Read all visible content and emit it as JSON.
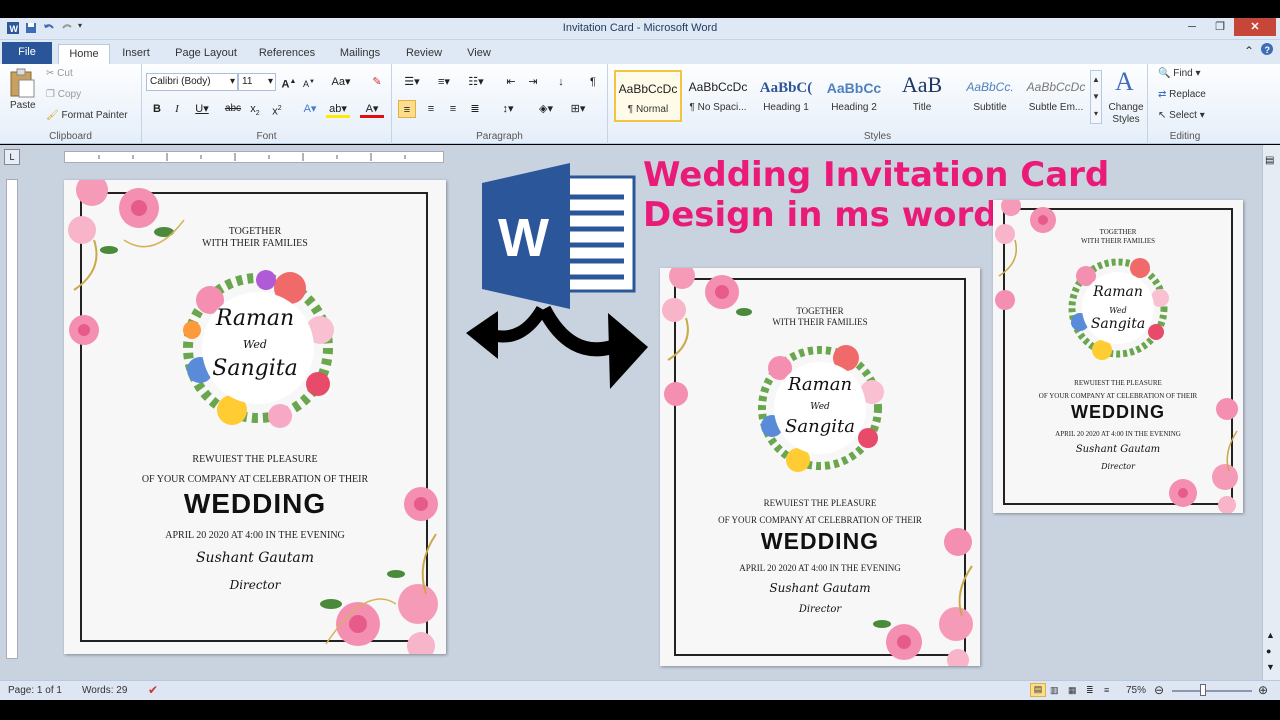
{
  "window": {
    "title": "Invitation Card - Microsoft Word"
  },
  "tabs": [
    "File",
    "Home",
    "Insert",
    "Page Layout",
    "References",
    "Mailings",
    "Review",
    "View"
  ],
  "clipboard": {
    "paste": "Paste",
    "cut": "Cut",
    "copy": "Copy",
    "format_painter": "Format Painter",
    "label": "Clipboard"
  },
  "font": {
    "name": "Calibri (Body)",
    "size": "11",
    "label": "Font"
  },
  "paragraph": {
    "label": "Paragraph"
  },
  "styles": {
    "items": [
      {
        "sample": "AaBbCcDc",
        "name": "¶ Normal"
      },
      {
        "sample": "AaBbCcDc",
        "name": "¶ No Spaci..."
      },
      {
        "sample": "AaBbC(",
        "name": "Heading 1"
      },
      {
        "sample": "AaBbCc",
        "name": "Heading 2"
      },
      {
        "sample": "AaB",
        "name": "Title"
      },
      {
        "sample": "AaBbCc.",
        "name": "Subtitle"
      },
      {
        "sample": "AaBbCcDc",
        "name": "Subtle Em..."
      }
    ],
    "change_styles": "Change Styles",
    "label": "Styles"
  },
  "editing": {
    "find": "Find",
    "replace": "Replace",
    "select": "Select",
    "label": "Editing"
  },
  "headline": {
    "line1": "Wedding Invitation Card",
    "line2": "Design in ms word"
  },
  "word_logo_letter": "W",
  "card": {
    "together": "TOGETHER",
    "families": "WITH THEIR FAMILIES",
    "name1": "Raman",
    "wed": "Wed",
    "name2": "Sangita",
    "request": "REWUIEST THE PLEASURE",
    "company": "OF YOUR COMPANY AT CELEBRATION OF THEIR",
    "wedding": "WEDDING",
    "date": "APRIL 20 2020 AT 4:00 IN THE EVENING",
    "signer": "Sushant Gautam",
    "role": "Director"
  },
  "status": {
    "page": "Page: 1 of 1",
    "words": "Words: 29",
    "zoom": "75%"
  },
  "colors": {
    "accent": "#ea1b78",
    "word_blue": "#2b579a",
    "file_tab": "#2a5699"
  }
}
